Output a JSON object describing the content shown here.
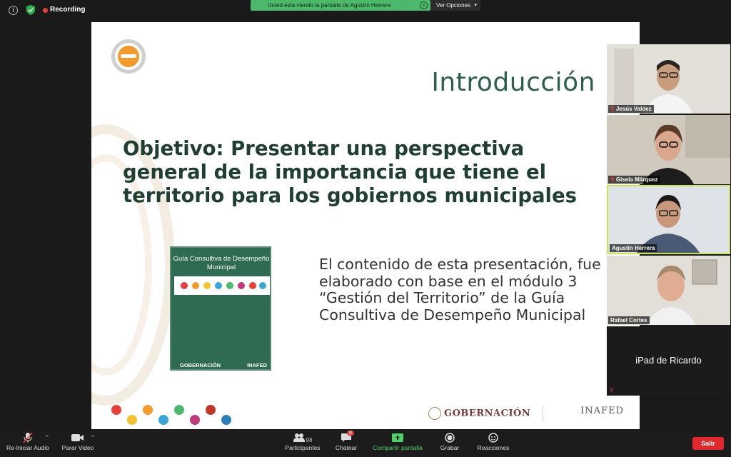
{
  "topbar": {
    "recording_label": "Recording",
    "share_banner": "Usted está viendo la pantalla de Agustín Herrera",
    "view_options": "Ver Opciones"
  },
  "slide": {
    "title": "Introducción",
    "objective": "Objetivo: Presentar una perspectiva general de la importancia que tiene el territorio para los gobiernos municipales",
    "content": "El contenido de esta presentación, fue elaborado con base en el módulo 3 “Gestión del Territorio” de la Guía Consultiva de Desempeño Municipal",
    "book": {
      "title": "Guía Consultiva de Desempeño Municipal",
      "footer_left": "GOBERNACIÓN",
      "footer_right": "INAFED"
    },
    "footer": {
      "gobernacion": "GOBERNACIÓN",
      "inafed": "INAFED"
    }
  },
  "participants": [
    {
      "name": "Jesús Valdez"
    },
    {
      "name": "Gisela Márquez"
    },
    {
      "name": "Agustín Herrera"
    },
    {
      "name": "Rafael Cortes"
    },
    {
      "name": "iPad de Ricardo"
    }
  ],
  "toolbar": {
    "audio": "Re-Iniciar Audio",
    "video": "Parar Video",
    "participants": "Participantes",
    "participants_count": "98",
    "chat": "Chatear",
    "chat_badge": "8",
    "share": "Compartir pantalla",
    "record": "Grabar",
    "reactions": "Reacciones",
    "leave": "Salir"
  },
  "colors": {
    "accent_green": "#4cb86b",
    "slide_title": "#2e5e4e",
    "leave_red": "#e0282e",
    "active_speaker": "#c6e35a"
  }
}
